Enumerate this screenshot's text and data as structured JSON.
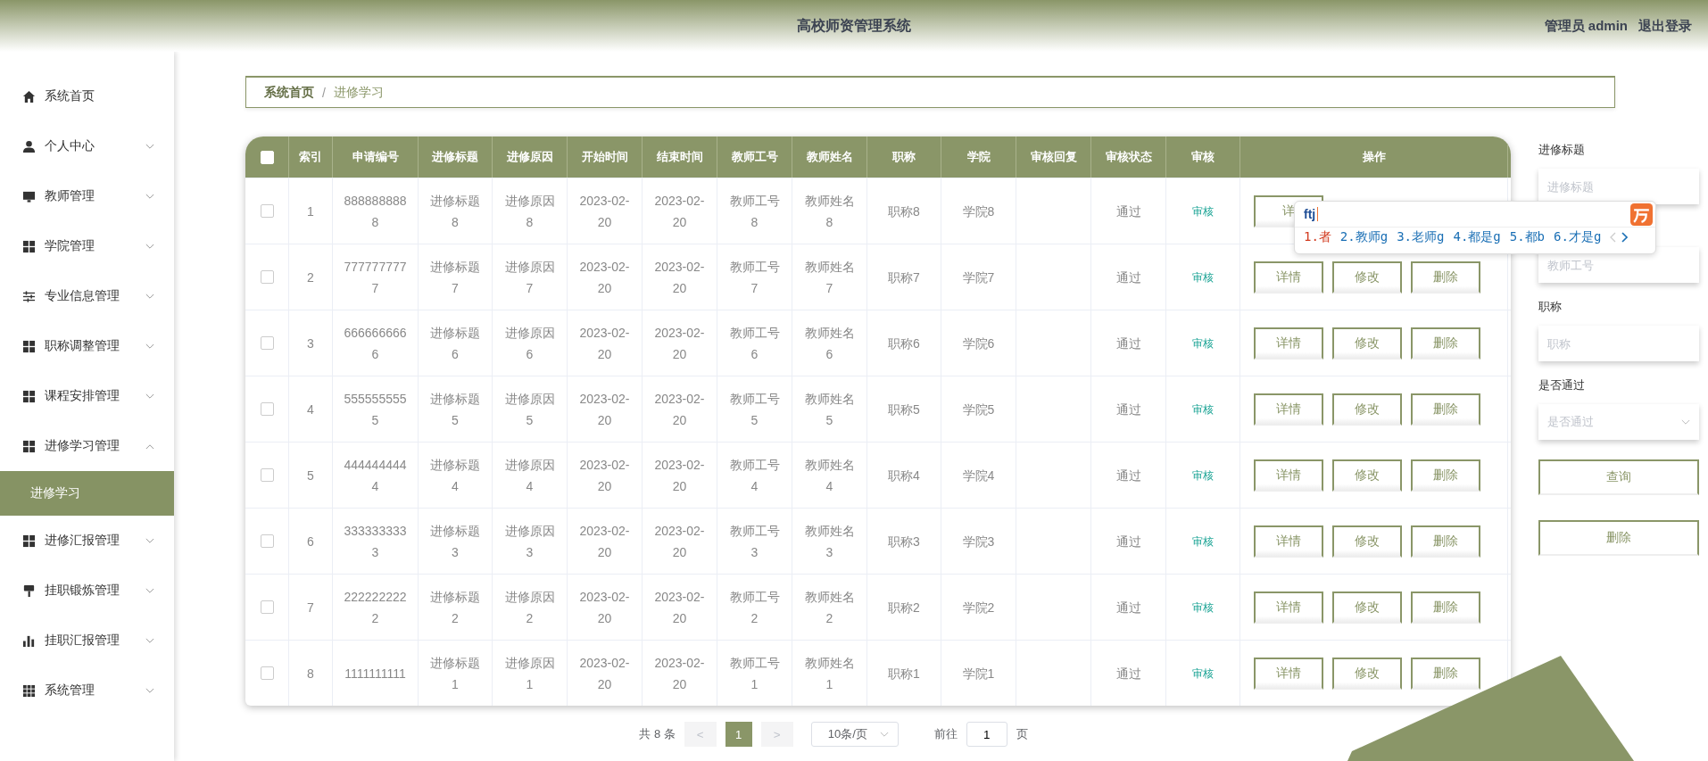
{
  "header": {
    "title": "高校师资管理系统",
    "user": "管理员 admin",
    "logout": "退出登录"
  },
  "sidebar": {
    "items": [
      {
        "label": "系统首页",
        "kind": "link"
      },
      {
        "label": "个人中心",
        "kind": "menu",
        "expanded": false
      },
      {
        "label": "教师管理",
        "kind": "menu",
        "expanded": false
      },
      {
        "label": "学院管理",
        "kind": "menu",
        "expanded": false
      },
      {
        "label": "专业信息管理",
        "kind": "menu",
        "expanded": false
      },
      {
        "label": "职称调整管理",
        "kind": "menu",
        "expanded": false
      },
      {
        "label": "课程安排管理",
        "kind": "menu",
        "expanded": false
      },
      {
        "label": "进修学习管理",
        "kind": "menu",
        "expanded": true,
        "children": [
          {
            "label": "进修学习",
            "selected": true
          }
        ]
      },
      {
        "label": "进修汇报管理",
        "kind": "menu",
        "expanded": false
      },
      {
        "label": "挂职锻炼管理",
        "kind": "menu",
        "expanded": false
      },
      {
        "label": "挂职汇报管理",
        "kind": "menu",
        "expanded": false
      },
      {
        "label": "系统管理",
        "kind": "menu",
        "expanded": false
      }
    ]
  },
  "breadcrumb": {
    "items": [
      "系统首页",
      "进修学习"
    ],
    "separator": "/"
  },
  "table": {
    "select_all_checked": false,
    "columns": [
      "索引",
      "申请编号",
      "进修标题",
      "进修原因",
      "开始时间",
      "结束时间",
      "教师工号",
      "教师姓名",
      "职称",
      "学院",
      "审核回复",
      "审核状态",
      "审核",
      "操作"
    ],
    "rows": [
      {
        "checked": false,
        "cells": [
          "1",
          "8888888888",
          "进修标题8",
          "进修原因8",
          "2023-02-20",
          "2023-02-20",
          "教师工号8",
          "教师姓名8",
          "职称8",
          "学院8",
          "",
          "通过"
        ],
        "audit": "审核",
        "actions": [
          "详"
        ]
      },
      {
        "checked": false,
        "cells": [
          "2",
          "7777777777",
          "进修标题7",
          "进修原因7",
          "2023-02-20",
          "2023-02-20",
          "教师工号7",
          "教师姓名7",
          "职称7",
          "学院7",
          "",
          "通过"
        ],
        "audit": "审核",
        "actions": [
          "详情",
          "修改",
          "删除"
        ]
      },
      {
        "checked": false,
        "cells": [
          "3",
          "6666666666",
          "进修标题6",
          "进修原因6",
          "2023-02-20",
          "2023-02-20",
          "教师工号6",
          "教师姓名6",
          "职称6",
          "学院6",
          "",
          "通过"
        ],
        "audit": "审核",
        "actions": [
          "详情",
          "修改",
          "删除"
        ]
      },
      {
        "checked": false,
        "cells": [
          "4",
          "5555555555",
          "进修标题5",
          "进修原因5",
          "2023-02-20",
          "2023-02-20",
          "教师工号5",
          "教师姓名5",
          "职称5",
          "学院5",
          "",
          "通过"
        ],
        "audit": "审核",
        "actions": [
          "详情",
          "修改",
          "删除"
        ]
      },
      {
        "checked": false,
        "cells": [
          "5",
          "4444444444",
          "进修标题4",
          "进修原因4",
          "2023-02-20",
          "2023-02-20",
          "教师工号4",
          "教师姓名4",
          "职称4",
          "学院4",
          "",
          "通过"
        ],
        "audit": "审核",
        "actions": [
          "详情",
          "修改",
          "删除"
        ]
      },
      {
        "checked": false,
        "cells": [
          "6",
          "3333333333",
          "进修标题3",
          "进修原因3",
          "2023-02-20",
          "2023-02-20",
          "教师工号3",
          "教师姓名3",
          "职称3",
          "学院3",
          "",
          "通过"
        ],
        "audit": "审核",
        "actions": [
          "详情",
          "修改",
          "删除"
        ]
      },
      {
        "checked": false,
        "cells": [
          "7",
          "2222222222",
          "进修标题2",
          "进修原因2",
          "2023-02-20",
          "2023-02-20",
          "教师工号2",
          "教师姓名2",
          "职称2",
          "学院2",
          "",
          "通过"
        ],
        "audit": "审核",
        "actions": [
          "详情",
          "修改",
          "删除"
        ]
      },
      {
        "checked": false,
        "cells": [
          "8",
          "1111111111",
          "进修标题1",
          "进修原因1",
          "2023-02-20",
          "2023-02-20",
          "教师工号1",
          "教师姓名1",
          "职称1",
          "学院1",
          "",
          "通过"
        ],
        "audit": "审核",
        "actions": [
          "详情",
          "修改",
          "删除"
        ]
      }
    ]
  },
  "pagination": {
    "total": "共 8 条",
    "prev": "<",
    "pages": [
      {
        "label": "1",
        "selected": true
      }
    ],
    "next": ">",
    "page_size": "10条/页",
    "goto": "前往",
    "goto_value": "1",
    "page_unit": "页"
  },
  "filters": [
    {
      "kind": "text",
      "label": "进修标题",
      "placeholder": "进修标题"
    },
    {
      "kind": "text",
      "placeholder": "教师工号"
    },
    {
      "kind": "text",
      "label": "职称",
      "placeholder": "职称"
    },
    {
      "kind": "select",
      "label": "是否通过",
      "placeholder": "是否通过"
    }
  ],
  "filter_buttons": [
    "查询",
    "删除"
  ],
  "ime": {
    "input": "ftj",
    "candidates": [
      {
        "text": "1.者",
        "selected": true
      },
      {
        "text": "2.教师g",
        "selected": false
      },
      {
        "text": "3.老师g",
        "selected": false
      },
      {
        "text": "4.都是g",
        "selected": false
      },
      {
        "text": "5.都b",
        "selected": false
      },
      {
        "text": "6.才是g",
        "selected": false
      }
    ]
  }
}
